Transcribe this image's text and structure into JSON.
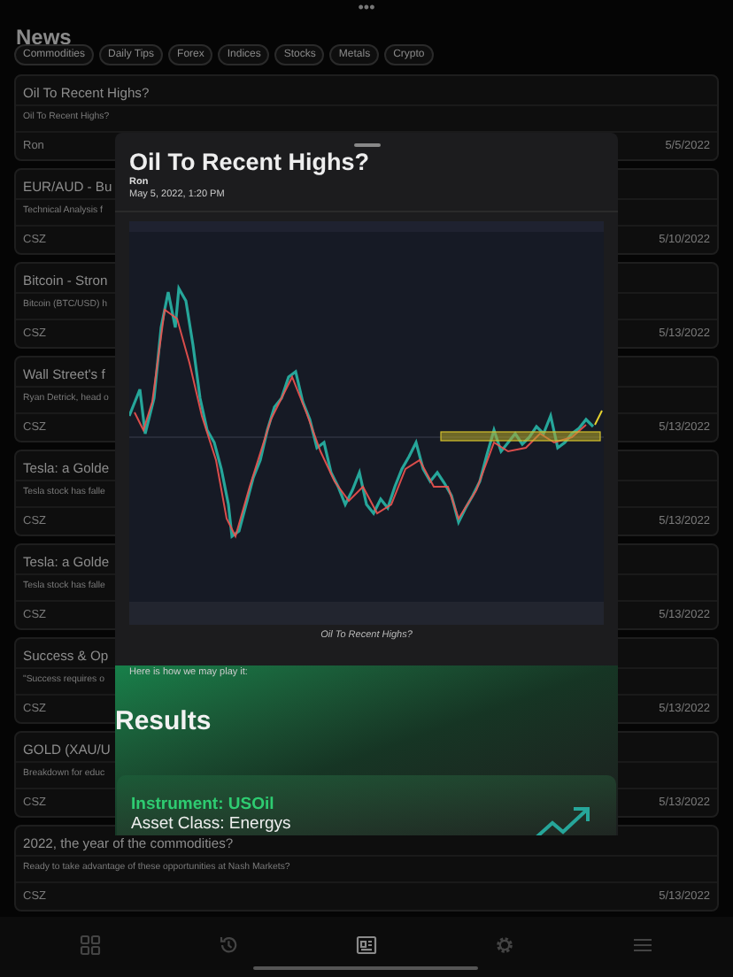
{
  "header": {
    "more": "•••",
    "title": "News"
  },
  "filters": [
    {
      "label": "Commodities",
      "selected": false
    },
    {
      "label": "Daily Tips",
      "selected": false
    },
    {
      "label": "Forex",
      "selected": false
    },
    {
      "label": "Indices",
      "selected": false
    },
    {
      "label": "Stocks",
      "selected": false
    },
    {
      "label": "Metals",
      "selected": false
    },
    {
      "label": "Crypto",
      "selected": false
    }
  ],
  "articles": [
    {
      "title": "Oil To Recent Highs?",
      "summary": "Oil To Recent Highs?",
      "author": "Ron",
      "date": "5/5/2022"
    },
    {
      "title": "EUR/AUD - Bu",
      "summary": "Technical Analysis f",
      "author": "CSZ",
      "date": "5/10/2022"
    },
    {
      "title": "Bitcoin - Stron",
      "summary": "Bitcoin (BTC/USD) h",
      "author": "CSZ",
      "date": "5/13/2022"
    },
    {
      "title": "Wall Street's f",
      "summary": "Ryan Detrick, head o",
      "author": "CSZ",
      "date": "5/13/2022"
    },
    {
      "title": "Tesla: a Golde",
      "summary": "Tesla stock has falle",
      "author": "CSZ",
      "date": "5/13/2022"
    },
    {
      "title": "Tesla: a Golde",
      "summary": "Tesla stock has falle",
      "author": "CSZ",
      "date": "5/13/2022"
    },
    {
      "title": "Success & Op",
      "summary": "\"Success requires o",
      "author": "CSZ",
      "date": "5/13/2022"
    },
    {
      "title": "GOLD (XAU/U",
      "summary": "Breakdown for educ",
      "author": "CSZ",
      "date": "5/13/2022"
    },
    {
      "title": "2022, the year of the commodities?",
      "summary": "Ready to take advantage of these opportunities at Nash Markets?",
      "author": "CSZ",
      "date": "5/13/2022"
    }
  ],
  "sheet": {
    "title": "Oil To Recent Highs?",
    "author": "Ron",
    "date": "May 5, 2022, 1:20 PM",
    "caption": "Oil To Recent Highs?",
    "intro": "Here is how we may play it:",
    "results_heading": "Results",
    "instrument": "Instrument: USOil",
    "asset_class": "Asset Class: Energys"
  },
  "tab_bar": [
    {
      "selected": false
    },
    {
      "selected": false
    },
    {
      "selected": true
    },
    {
      "selected": false
    },
    {
      "selected": false
    }
  ]
}
